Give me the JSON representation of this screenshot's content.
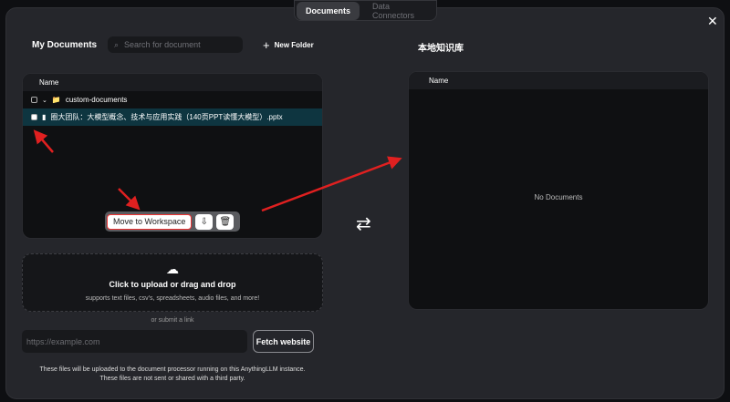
{
  "tabs": [
    "Documents",
    "Data Connectors"
  ],
  "close_icon": "close-icon",
  "my_documents": {
    "title": "My Documents",
    "search_placeholder": "Search for document",
    "new_folder": "New Folder",
    "column": "Name",
    "folder": "custom-documents",
    "file": "圈大团队：大模型概念、技术与应用实践（140页PPT读懂大模型）.pptx",
    "move_button": "Move to Workspace"
  },
  "upload": {
    "title": "Click to upload or drag and drop",
    "subtitle": "supports text files, csv's, spreadsheets, audio files, and more!",
    "or_link": "or submit a link",
    "link_placeholder": "https://example.com",
    "fetch_button": "Fetch website",
    "footer1": "These files will be uploaded to the document processor running on this AnythingLLM instance.",
    "footer2": "These files are not sent or shared with a third party."
  },
  "workspace": {
    "title": "本地知识库",
    "column": "Name",
    "empty": "No Documents"
  },
  "colors": {
    "selected_row": "#0e3540",
    "annotation": "#e02020"
  }
}
